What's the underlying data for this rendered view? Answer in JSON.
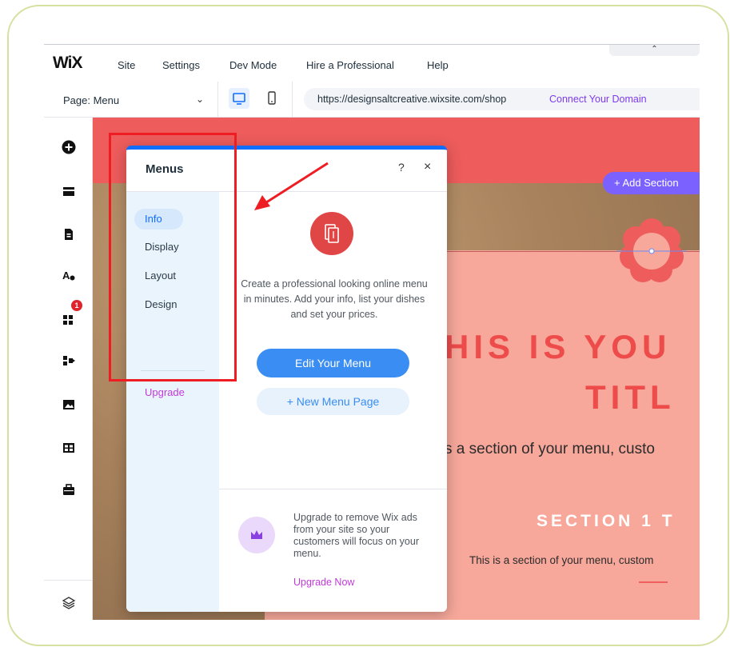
{
  "topbar": {
    "logo": "WiX",
    "menu": [
      "Site",
      "Settings",
      "Dev Mode",
      "Hire a Professional",
      "Help"
    ],
    "collapse_glyph": "⌃"
  },
  "secondbar": {
    "page_label": "Page: Menu",
    "chevron": "⌄",
    "url": "https://designsaltcreative.wixsite.com/shop",
    "connect_domain": "Connect Your Domain"
  },
  "rail_icons": [
    "add-icon",
    "sections-icon",
    "pages-icon",
    "theme-icon",
    "apps-icon",
    "business-apps-icon",
    "media-icon",
    "table-icon",
    "portfolio-icon",
    "layers-icon"
  ],
  "rail_badge": "1",
  "canvas": {
    "add_section": "+ Add Section",
    "title_line1": "HIS IS YOU",
    "title_line2": "TITL",
    "subtitle": "s a section of your menu, custo",
    "section_title": "SECTION 1 T",
    "section_text": "This is a section of your menu, custom"
  },
  "panel": {
    "title": "Menus",
    "help": "?",
    "close": "×",
    "tabs": [
      "Info",
      "Display",
      "Layout",
      "Design"
    ],
    "active_tab": "Info",
    "upgrade_tab": "Upgrade",
    "description": "Create a professional looking online menu in minutes. Add your info, list your dishes and set your prices.",
    "edit_button": "Edit Your Menu",
    "new_page_button": "+ New Menu Page",
    "upgrade_text": "Upgrade to remove Wix ads from your site so your customers will focus on your menu.",
    "upgrade_now": "Upgrade Now"
  },
  "colors": {
    "accent": "#116dff",
    "upgrade": "#c03ad9",
    "annotation": "#ee1d23",
    "hero_red": "#ee5c5c",
    "salmon": "#f7a89b"
  }
}
